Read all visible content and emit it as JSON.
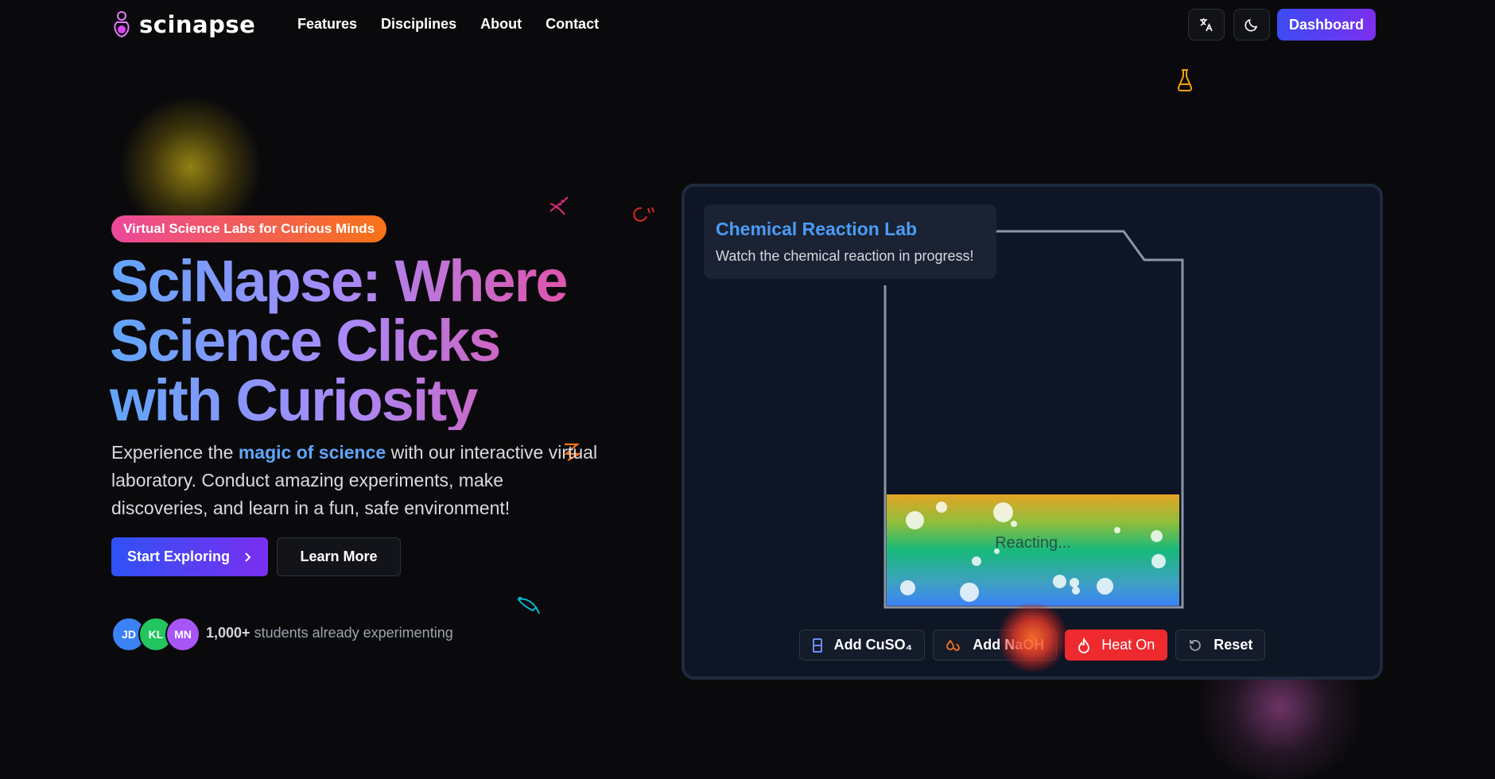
{
  "nav": {
    "logo_text": "scinapse",
    "links": [
      "Features",
      "Disciplines",
      "About",
      "Contact"
    ],
    "translate_icon": "translate-icon",
    "theme_icon": "moon-icon",
    "dashboard_label": "Dashboard"
  },
  "hero": {
    "badge": "Virtual Science Labs for Curious Minds",
    "title": "SciNapse: Where Science Clicks with Curiosity",
    "desc_before": "Experience the ",
    "desc_highlight": "magic of science",
    "desc_after": " with our interactive virtual laboratory. Conduct amazing experiments, make discoveries, and learn in a fun, safe environment!",
    "primary_cta": "Start Exploring",
    "secondary_cta": "Learn More",
    "avatars": [
      {
        "initials": "JD",
        "color": "#3b82f6"
      },
      {
        "initials": "KL",
        "color": "#22c55e"
      },
      {
        "initials": "MN",
        "color": "#a855f7"
      }
    ],
    "students_count": "1,000+",
    "students_text": " students already experimenting"
  },
  "lab": {
    "title": "Chemical Reaction Lab",
    "subtitle": "Watch the chemical reaction in progress!",
    "status": "Reacting...",
    "controls": {
      "add_cuso4": "Add CuSO₄",
      "add_naoh": "Add NaOH",
      "heat": "Heat On",
      "reset": "Reset"
    }
  },
  "colors": {
    "accent_blue": "#3b4cf2",
    "accent_purple": "#7c2ff0",
    "heat_red": "#ef2a2f",
    "lab_title": "#4b9cf5"
  }
}
